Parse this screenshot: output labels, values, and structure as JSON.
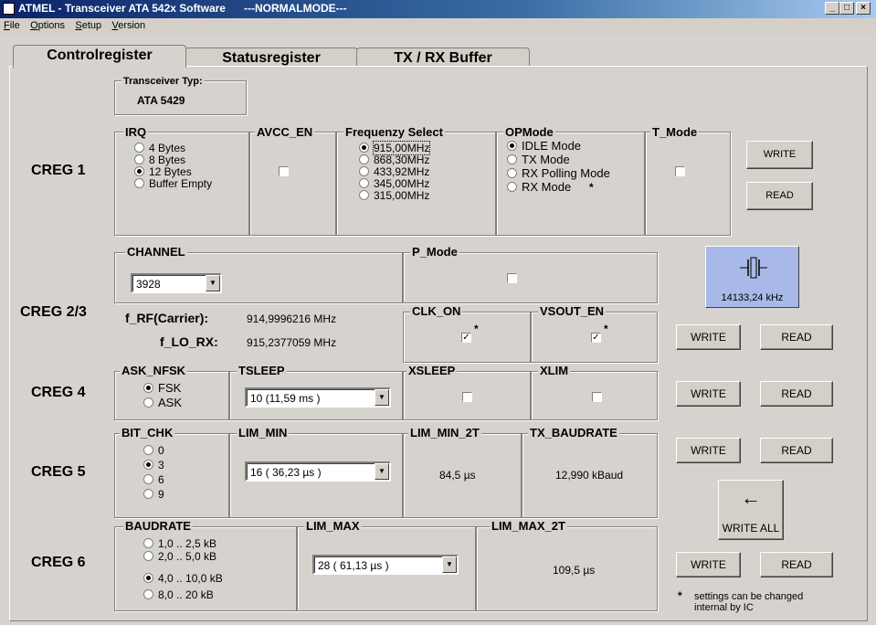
{
  "window": {
    "title": "ATMEL - Transceiver ATA 542x Software      ---NORMALMODE---",
    "min": "_",
    "max": "□",
    "close": "×"
  },
  "menu": [
    "File",
    "Options",
    "Setup",
    "Version"
  ],
  "tabs": [
    "Controlregister",
    "Statusregister",
    "TX / RX Buffer"
  ],
  "transceiver": {
    "title": "Transceiver Typ:",
    "value": "ATA 5429"
  },
  "creg1": {
    "label": "CREG 1",
    "irq": {
      "title": "IRQ",
      "options": [
        "4 Bytes",
        "8 Bytes",
        "12 Bytes",
        "Buffer Empty"
      ],
      "selected": 2
    },
    "avcc": {
      "title": "AVCC_EN",
      "checked": false
    },
    "freq": {
      "title": "Frequenzy Select",
      "options": [
        "915,00MHz",
        "868,30MHz",
        "433,92MHz",
        "345,00MHz",
        "315,00MHz"
      ],
      "selected": 0
    },
    "opmode": {
      "title": "OPMode",
      "options": [
        "IDLE Mode",
        "TX Mode",
        "RX Polling Mode",
        "RX Mode"
      ],
      "selected": 0,
      "star": "*"
    },
    "tmode": {
      "title": "T_Mode",
      "checked": false
    },
    "write": "WRITE",
    "read": "READ"
  },
  "creg23": {
    "label": "CREG 2/3",
    "channel": {
      "title": "CHANNEL",
      "value": "3928"
    },
    "pmode": {
      "title": "P_Mode",
      "checked": false
    },
    "frf_label": "f_RF(Carrier):",
    "frf_value": "914,9996216 MHz",
    "flo_label": "f_LO_RX:",
    "flo_value": "915,2377059 MHz",
    "clkon": {
      "title": "CLK_ON",
      "checked": true,
      "star": "*"
    },
    "vsout": {
      "title": "VSOUT_EN",
      "checked": true,
      "star": "*"
    },
    "crystal_freq": "14133,24 kHz",
    "write": "WRITE",
    "read": "READ"
  },
  "creg4": {
    "label": "CREG 4",
    "asknfsk": {
      "title": "ASK_NFSK",
      "options": [
        "FSK",
        "ASK"
      ],
      "selected": 0
    },
    "tsleep": {
      "title": "TSLEEP",
      "value": "10 (11,59 ms )"
    },
    "xsleep": {
      "title": "XSLEEP",
      "checked": false
    },
    "xlim": {
      "title": "XLIM",
      "checked": false
    },
    "write": "WRITE",
    "read": "READ"
  },
  "creg5": {
    "label": "CREG 5",
    "bitchk": {
      "title": "BIT_CHK",
      "options": [
        "0",
        "3",
        "6",
        "9"
      ],
      "selected": 1
    },
    "limmin": {
      "title": "LIM_MIN",
      "value": "16 ( 36,23 µs )"
    },
    "limmin2t": {
      "title": "LIM_MIN_2T",
      "value": "84,5 µs"
    },
    "txbaud": {
      "title": "TX_BAUDRATE",
      "value": "12,990 kBaud"
    },
    "write": "WRITE",
    "read": "READ"
  },
  "creg6": {
    "label": "CREG 6",
    "baud": {
      "title": "BAUDRATE",
      "options": [
        "1,0 .. 2,5 kB",
        "2,0 .. 5,0 kB",
        "4,0 .. 10,0 kB",
        "8,0 .. 20 kB"
      ],
      "selected": 2
    },
    "limmax": {
      "title": "LIM_MAX",
      "value": "28 ( 61,13 µs )"
    },
    "limmax2t": {
      "title": "LIM_MAX_2T",
      "value": "109,5 µs"
    },
    "write": "WRITE",
    "read": "READ"
  },
  "writeall": {
    "arrow": "←",
    "label": "WRITE ALL"
  },
  "footnote": {
    "star": "*",
    "text": "settings can be changed internal by IC"
  }
}
